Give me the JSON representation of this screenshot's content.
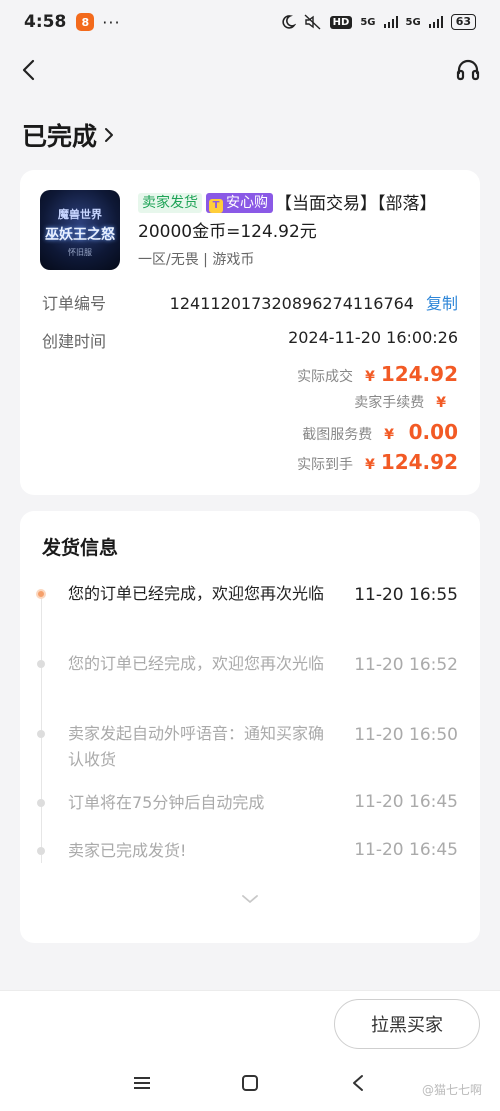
{
  "status_bar": {
    "time": "4:58",
    "dots": "···",
    "hd": "HD",
    "net1": "5G",
    "net2": "5G",
    "battery": "63"
  },
  "page": {
    "title": "已完成"
  },
  "order": {
    "tag_seller": "卖家发货",
    "tag_safe": "安心购",
    "product_title": "【当面交易】【部落】20000金币=124.92元",
    "product_sub": "一区/无畏 | 游戏币",
    "thumb_text": "魔兽世界",
    "thumb_title": "巫妖王之怒",
    "thumb_sub": "怀旧服",
    "order_no_label": "订单编号",
    "order_no": "1241120173208962741167​64",
    "copy_label": "复制",
    "created_label": "创建时间",
    "created_value": "2024-11-20 16:00:26",
    "prices": [
      {
        "label": "实际成交",
        "yen": "¥",
        "amount": "124.92"
      },
      {
        "label": "卖家手续费",
        "yen": "¥",
        "amount": ""
      },
      {
        "label": "截图服务费",
        "yen": "¥",
        "amount": "0.00"
      },
      {
        "label": "实际到手",
        "yen": "¥",
        "amount": "124.92"
      }
    ]
  },
  "shipping": {
    "title": "发货信息",
    "events": [
      {
        "text": "您的订单已经完成，欢迎您再次光临",
        "time": "11-20 16:55"
      },
      {
        "text": "您的订单已经完成，欢迎您再次光临",
        "time": "11-20 16:52"
      },
      {
        "text": "卖家发起自动外呼语音：通知买家确认收货",
        "time": "11-20 16:50"
      },
      {
        "text": "订单将在75分钟后自动完成",
        "time": "11-20 16:45"
      },
      {
        "text": "卖家已完成发货!",
        "time": "11-20 16:45"
      }
    ]
  },
  "bottom": {
    "block_label": "拉黑买家",
    "watermark": "@猫七七啊"
  },
  "colors": {
    "accent_orange": "#f25a25",
    "link_blue": "#2e86d8",
    "tag_green": "#1fa357",
    "tag_purple": "#8a59e6"
  }
}
